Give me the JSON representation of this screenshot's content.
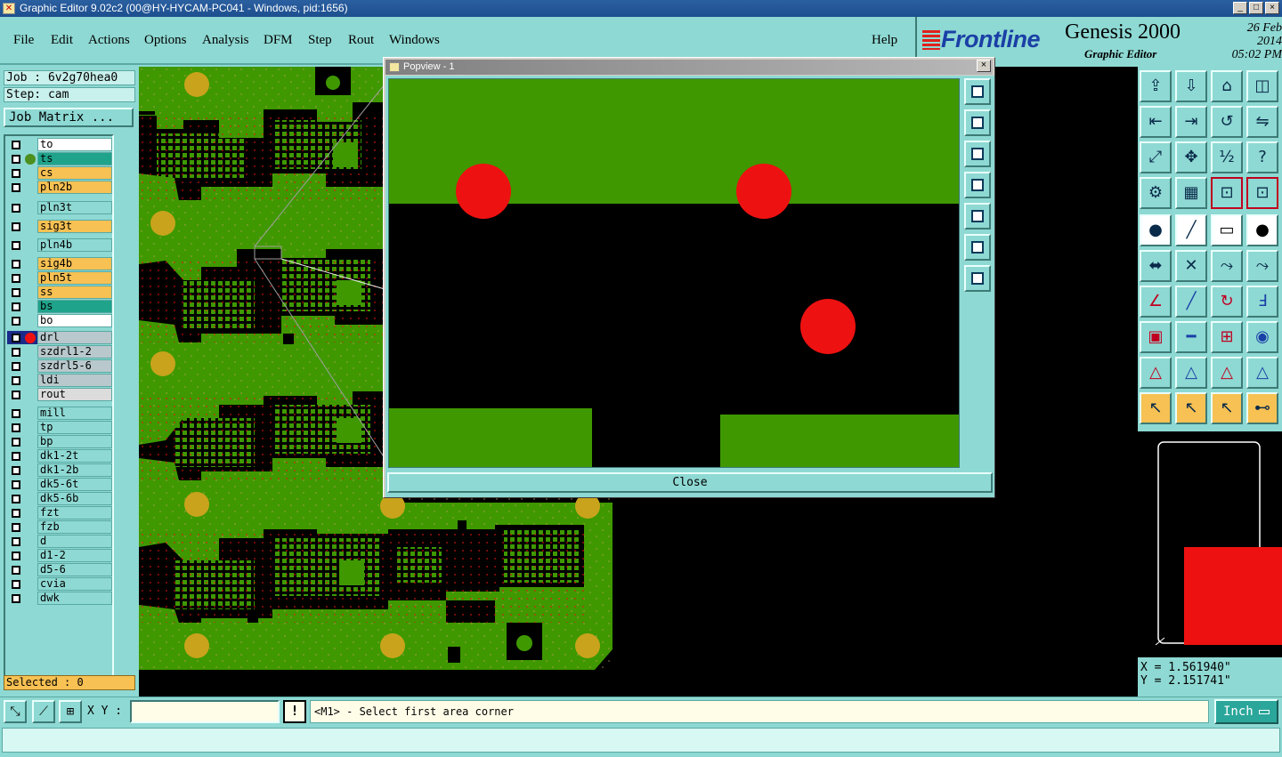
{
  "window": {
    "title": "Graphic Editor 9.02c2 (00@HY-HYCAM-PC041 - Windows, pid:1656)",
    "btn_min": "_",
    "btn_max": "□",
    "btn_close": "×"
  },
  "menu": {
    "items": [
      "File",
      "Edit",
      "Actions",
      "Options",
      "Analysis",
      "DFM",
      "Step",
      "Rout",
      "Windows"
    ],
    "help": "Help"
  },
  "brand": {
    "logo": "Frontline",
    "product": "Genesis 2000",
    "subtitle": "Graphic Editor",
    "date": "26 Feb 2014",
    "time": "05:02 PM"
  },
  "job": {
    "job_line": "Job : 6v2g70hea0",
    "step_line": "Step: cam",
    "matrix_button": "Job Matrix ..."
  },
  "layers": [
    {
      "name": "to",
      "bg": "#ffffff",
      "dot": ""
    },
    {
      "name": "ts",
      "bg": "#1fa38a",
      "dot": "#4c8f1e"
    },
    {
      "name": "cs",
      "bg": "#f7c153",
      "dot": ""
    },
    {
      "name": "pln2b",
      "bg": "#f7c153",
      "dot": ""
    },
    {
      "name": "pln3t",
      "bg": "#8ed9d3",
      "dot": ""
    },
    {
      "name": "sig3t",
      "bg": "#f7c153",
      "dot": ""
    },
    {
      "name": "pln4b",
      "bg": "#8ed9d3",
      "dot": ""
    },
    {
      "name": "sig4b",
      "bg": "#f7c153",
      "dot": ""
    },
    {
      "name": "pln5t",
      "bg": "#f7c153",
      "dot": ""
    },
    {
      "name": "ss",
      "bg": "#f7c153",
      "dot": ""
    },
    {
      "name": "bs",
      "bg": "#1fa38a",
      "dot": ""
    },
    {
      "name": "bo",
      "bg": "#ffffff",
      "dot": ""
    },
    {
      "name": "drl",
      "bg": "#b8c8cc",
      "dot": "#ee1111"
    },
    {
      "name": "szdrl1-2",
      "bg": "#b8c8cc",
      "dot": ""
    },
    {
      "name": "szdrl5-6",
      "bg": "#b8c8cc",
      "dot": ""
    },
    {
      "name": "ldi",
      "bg": "#b8c8cc",
      "dot": ""
    },
    {
      "name": "rout",
      "bg": "#dcdcdc",
      "dot": ""
    },
    {
      "name": "mill",
      "bg": "#8ed9d3",
      "dot": ""
    },
    {
      "name": "tp",
      "bg": "#8ed9d3",
      "dot": ""
    },
    {
      "name": "bp",
      "bg": "#8ed9d3",
      "dot": ""
    },
    {
      "name": "dk1-2t",
      "bg": "#8ed9d3",
      "dot": ""
    },
    {
      "name": "dk1-2b",
      "bg": "#8ed9d3",
      "dot": ""
    },
    {
      "name": "dk5-6t",
      "bg": "#8ed9d3",
      "dot": ""
    },
    {
      "name": "dk5-6b",
      "bg": "#8ed9d3",
      "dot": ""
    },
    {
      "name": "fzt",
      "bg": "#8ed9d3",
      "dot": ""
    },
    {
      "name": "fzb",
      "bg": "#8ed9d3",
      "dot": ""
    },
    {
      "name": "d",
      "bg": "#8ed9d3",
      "dot": ""
    },
    {
      "name": "d1-2",
      "bg": "#8ed9d3",
      "dot": ""
    },
    {
      "name": "d5-6",
      "bg": "#8ed9d3",
      "dot": ""
    },
    {
      "name": "cvia",
      "bg": "#8ed9d3",
      "dot": ""
    },
    {
      "name": "dwk",
      "bg": "#8ed9d3",
      "dot": ""
    }
  ],
  "selected": "Selected : 0",
  "popview": {
    "title": "Popview - 1",
    "close_x": "×",
    "close_button": "Close"
  },
  "coords": {
    "x": "X = 1.561940\"",
    "y": "Y = 2.151741\""
  },
  "bottom": {
    "xy_label": "X Y :",
    "xy_value": "",
    "excl": "!",
    "prompt": "<M1> - Select first area corner",
    "unit": "Inch"
  },
  "colors": {
    "board_green": "#3f9800",
    "pad_gold": "#c9a31c",
    "drill_red": "#ee1111",
    "panel_teal": "#8ed9d3"
  },
  "icons": [
    "layer-up-icon",
    "layer-down-icon",
    "home-icon",
    "split-view-icon",
    "prev-icon",
    "next-icon",
    "rotate-icon",
    "mirror-icon",
    "fit-icon",
    "pan-icon",
    "scale-1-2-icon",
    "help-icon",
    "settings-icon",
    "grid-icon",
    "snap-icon",
    "snap-pad-icon",
    "add-pad-icon",
    "draw-line-icon",
    "ruler-icon",
    "circle-icon",
    "connect-icon",
    "delete-icon",
    "move-icon",
    "copy-icon",
    "angle-icon",
    "line-icon",
    "arc-icon",
    "text-icon",
    "pad-edit-icon",
    "split-icon",
    "measure-icon",
    "group-icon",
    "triangle-icon",
    "triangle-a-icon",
    "triangle-b-icon",
    "triangle-c-icon",
    "select-icon",
    "select-box-icon",
    "select-circle-icon",
    "select-net-icon"
  ]
}
